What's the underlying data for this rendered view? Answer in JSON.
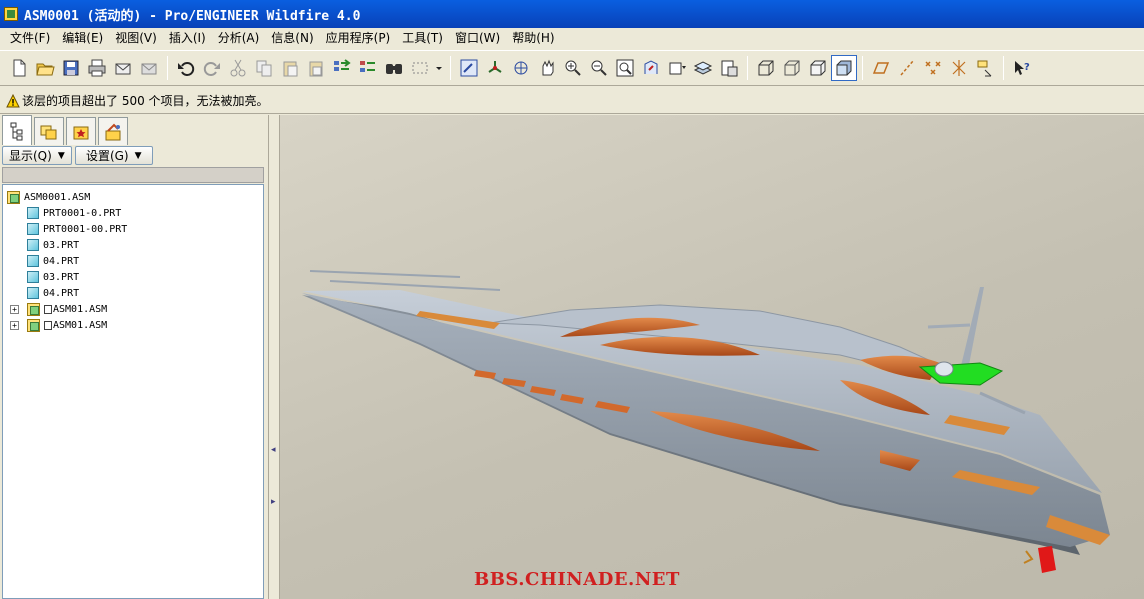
{
  "window": {
    "title": "ASM0001 (活动的) - Pro/ENGINEER Wildfire 4.0"
  },
  "menu": [
    "文件(F)",
    "编辑(E)",
    "视图(V)",
    "插入(I)",
    "分析(A)",
    "信息(N)",
    "应用程序(P)",
    "工具(T)",
    "窗口(W)",
    "帮助(H)"
  ],
  "toolbar": {
    "icons": [
      "new-file-icon",
      "open-folder-icon",
      "save-icon",
      "print-icon",
      "email-icon",
      "email-attach-icon",
      "undo-icon",
      "redo-icon",
      "cut-icon",
      "copy-icon",
      "paste-icon",
      "paste-special-icon",
      "regenerate-icon",
      "regen-manager-icon",
      "find-icon",
      "select-box-icon",
      "repaint-icon",
      "spin-center-icon",
      "orient-mode-icon",
      "pan-icon",
      "zoom-in-icon",
      "zoom-out-icon",
      "refit-icon",
      "reorient-icon",
      "saved-views-icon",
      "layers-icon",
      "view-manager-icon",
      "wireframe-icon",
      "hidden-line-icon",
      "no-hidden-icon",
      "shading-icon",
      "datum-plane-icon",
      "datum-axis-icon",
      "datum-point-icon",
      "coord-sys-icon",
      "annotation-icon",
      "context-help-icon"
    ]
  },
  "message": {
    "text": "该层的项目超出了 500 个项目，无法被加亮。"
  },
  "nav": {
    "show_label": "显示(Q)",
    "settings_label": "设置(G)",
    "tree": [
      {
        "label": "ASM0001.ASM",
        "type": "root"
      },
      {
        "label": "PRT0001-0.PRT",
        "type": "part"
      },
      {
        "label": "PRT0001-00.PRT",
        "type": "part"
      },
      {
        "label": "03.PRT",
        "type": "part"
      },
      {
        "label": "04.PRT",
        "type": "part"
      },
      {
        "label": "03.PRT",
        "type": "part"
      },
      {
        "label": "04.PRT",
        "type": "part"
      },
      {
        "label": "ASM01.ASM",
        "type": "subasm"
      },
      {
        "label": "ASM01.ASM",
        "type": "subasm"
      }
    ]
  },
  "viewport": {
    "watermark": "BBS.CHINADE.NET"
  },
  "colors": {
    "title_bar": "#0a5fe0",
    "hull": "#a9b3bf",
    "accent_orange": "#c9642e",
    "highlight_green": "#22dd22"
  }
}
